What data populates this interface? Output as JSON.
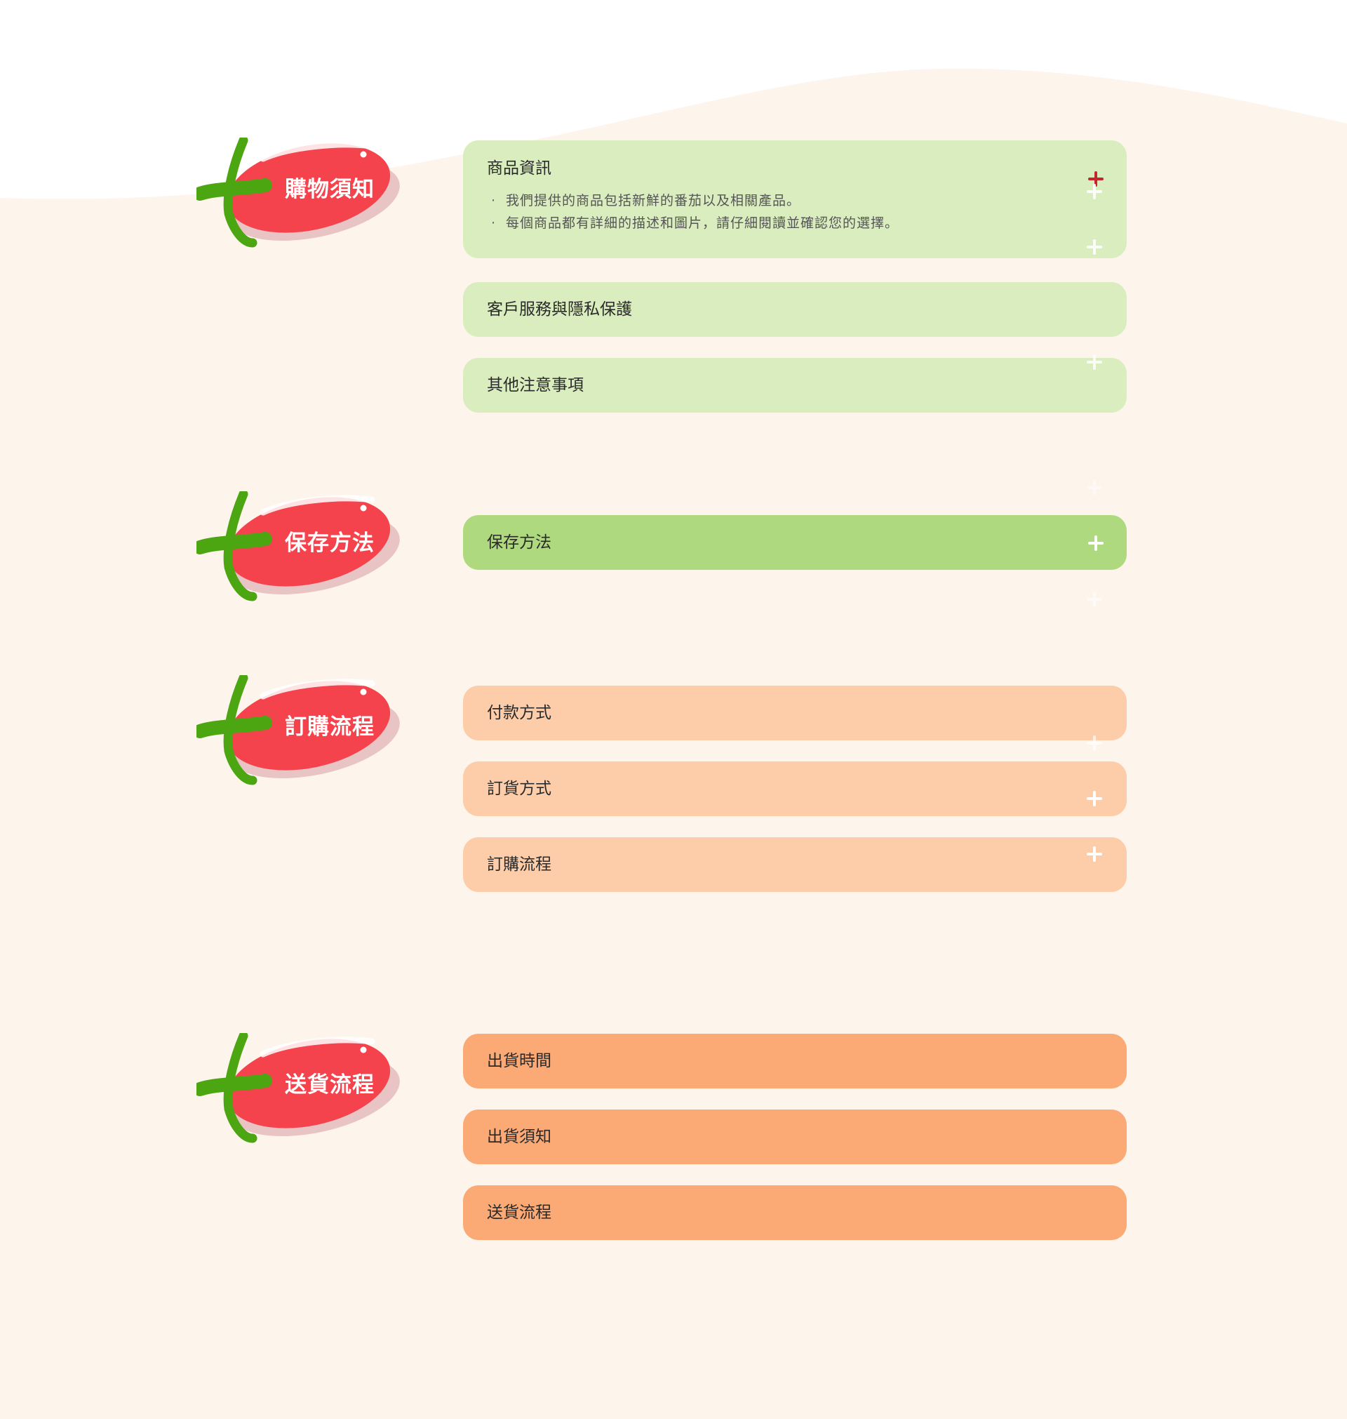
{
  "colors": {
    "page_bg": "#fdf4ec",
    "tomato": "#f5434d",
    "tomato_shadow": "#e8c4c4",
    "stem": "#4ca612",
    "light_green": "#d9edbe",
    "mid_green": "#afd97f",
    "light_orange": "#fdcda9",
    "orange": "#fba975",
    "active_plus": "#c0282e"
  },
  "sections": [
    {
      "badge": "購物須知",
      "items": [
        {
          "title": "商品資訊",
          "open": true,
          "bullets": [
            "我們提供的商品包括新鮮的番茄以及相關產品。",
            "每個商品都有詳細的描述和圖片，請仔細閱讀並確認您的選擇。"
          ]
        },
        {
          "title": "客戶服務與隱私保護"
        },
        {
          "title": "其他注意事項"
        }
      ]
    },
    {
      "badge": "保存方法",
      "items": [
        {
          "title": "保存方法"
        }
      ]
    },
    {
      "badge": "訂購流程",
      "items": [
        {
          "title": "付款方式"
        },
        {
          "title": "訂貨方式"
        },
        {
          "title": "訂購流程"
        }
      ]
    },
    {
      "badge": "送貨流程",
      "items": [
        {
          "title": "出貨時間"
        },
        {
          "title": "出貨須知"
        },
        {
          "title": "送貨流程"
        }
      ]
    }
  ]
}
